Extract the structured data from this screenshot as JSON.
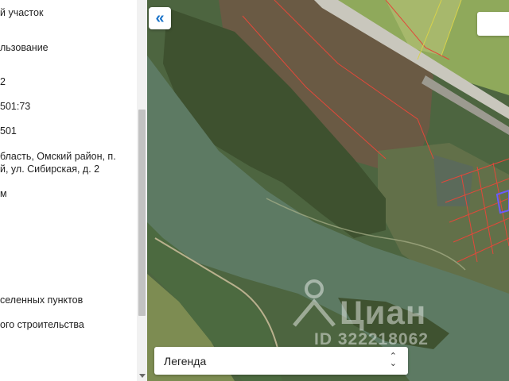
{
  "info_panel": {
    "lines": [
      "й участок",
      "льзование",
      "2",
      "501:73",
      "501",
      "бласть, Омский район, п.",
      "й, ул. Сибирская, д. 2",
      "м",
      "селенных пунктов",
      "ого строительства"
    ]
  },
  "map": {
    "collapse_button": "«",
    "legend_label": "Легенда",
    "legend_chevron": "⌃⌄",
    "watermark": {
      "brand": "Циан",
      "id": "ID 322218062"
    },
    "colors": {
      "river": "#5d7a63",
      "forest": "#4a5e38",
      "field": "#7f8a5c",
      "plot_lines": "#e2483a",
      "highlight_plot": "#6a5cff",
      "ui_accent": "#1a73c9"
    }
  }
}
